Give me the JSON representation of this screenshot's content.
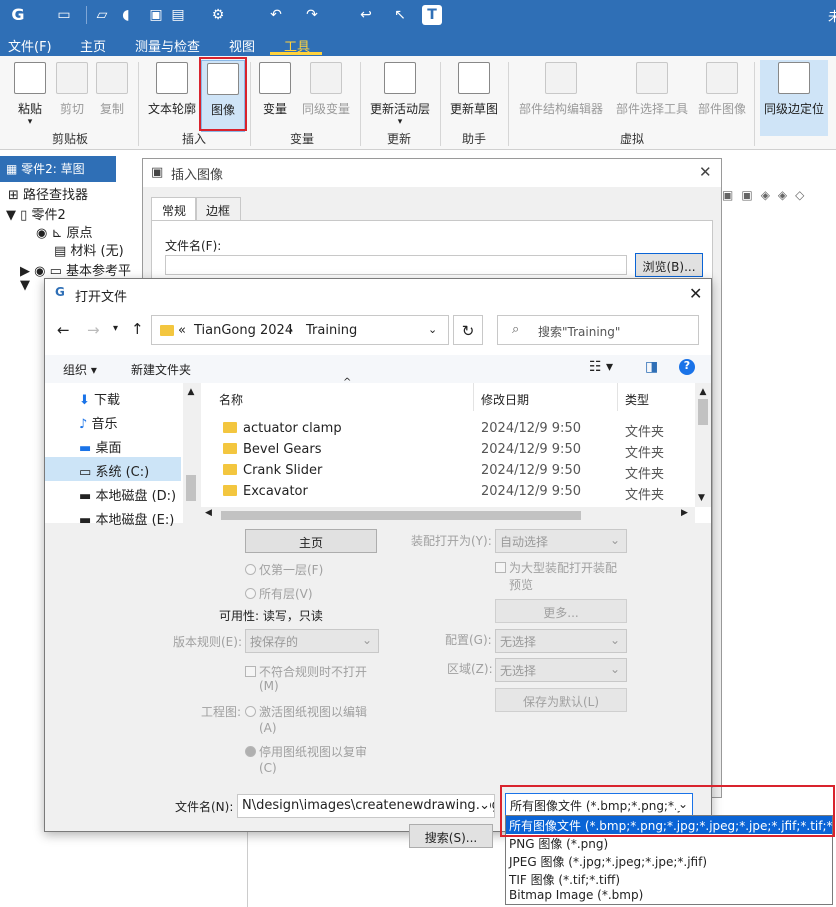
{
  "window": {
    "title_partial": "未"
  },
  "quick_access": [
    "logo-icon",
    "new-icon",
    "open-icon",
    "pin-icon",
    "save-icon",
    "save-as-icon",
    "settings-icon",
    "undo-icon",
    "redo-icon",
    "back-icon",
    "select-icon",
    "t-icon"
  ],
  "menubar": {
    "items": [
      "文件(F)",
      "主页",
      "测量与检查",
      "视图",
      "工具"
    ],
    "active": "工具"
  },
  "ribbon": {
    "groups": [
      {
        "name": "剪贴板",
        "buttons": [
          "粘贴",
          "剪切",
          "复制"
        ]
      },
      {
        "name": "插入",
        "buttons": [
          "文本轮廓",
          "图像"
        ]
      },
      {
        "name": "变量",
        "buttons": [
          "变量",
          "同级变量"
        ]
      },
      {
        "name": "更新",
        "buttons": [
          "更新活动层"
        ]
      },
      {
        "name": "助手",
        "buttons": [
          "更新草图"
        ]
      },
      {
        "name": "虚拟",
        "buttons": [
          "部件结构编辑器",
          "部件选择工具",
          "部件图像",
          "同级边定位"
        ]
      }
    ]
  },
  "document_tab": "零件2: 草图",
  "tree": {
    "title": "路径查找器",
    "items": [
      "零件2",
      "原点",
      "材料 (无)",
      "基本参考平"
    ]
  },
  "insert_image_dialog": {
    "title": "插入图像",
    "tabs": [
      "常规",
      "边框"
    ],
    "filename_label": "文件名(F):",
    "filename_value": "",
    "browse_button": "浏览(B)..."
  },
  "open_file_dialog": {
    "title": "打开文件",
    "breadcrumb": [
      "«",
      "TianGong 2024",
      "Training"
    ],
    "search_placeholder": "搜索\"Training\"",
    "organize": "组织 ▾",
    "new_folder": "新建文件夹",
    "nav_items": [
      "下载",
      "音乐",
      "桌面",
      "系统 (C:)",
      "本地磁盘 (D:)",
      "本地磁盘 (E:)"
    ],
    "selected_nav": "系统 (C:)",
    "columns": [
      "名称",
      "修改日期",
      "类型"
    ],
    "files": [
      {
        "name": "actuator clamp",
        "date": "2024/12/9 9:50",
        "type": "文件夹"
      },
      {
        "name": "Bevel Gears",
        "date": "2024/12/9 9:50",
        "type": "文件夹"
      },
      {
        "name": "Crank Slider",
        "date": "2024/12/9 9:50",
        "type": "文件夹"
      },
      {
        "name": "Excavator",
        "date": "2024/12/9 9:50",
        "type": "文件夹"
      }
    ],
    "options": {
      "home_button": "主页",
      "radio_first_level": "仅第一层(F)",
      "radio_all_levels": "所有层(V)",
      "availability": "可用性: 读写，只读",
      "version_rule_label": "版本规则(E):",
      "version_rule_value": "按保存的",
      "checkbox_noopen": "不符合规则时不打开",
      "checkbox_noopen_key": "(M)",
      "drawing_label": "工程图:",
      "radio_activate": "激活图纸视图以编辑",
      "radio_activate_key": "(A)",
      "radio_deactivate": "停用图纸视图以复审",
      "radio_deactivate_key": "(C)",
      "asm_open_label": "装配打开为(Y):",
      "asm_open_value": "自动选择",
      "large_asm_checkbox": "为大型装配打开装配",
      "large_asm_checkbox_2": "预览",
      "more_button": "更多...",
      "config_label": "配置(G):",
      "config_value": "无选择",
      "zone_label": "区域(Z):",
      "zone_value": "无选择",
      "save_default_button": "保存为默认(L)"
    },
    "filename_label": "文件名(N):",
    "filename_value": "N\\design\\images\\createnewdrawing.jpg",
    "search_button": "搜索(S)...",
    "filetype_value": "所有图像文件 (*.bmp;*.png;*.j",
    "filetype_options": [
      "所有图像文件 (*.bmp;*.png;*.jpg;*.jpeg;*.jpe;*.jfif;*.tif;*.tiff)",
      "PNG 图像 (*.png)",
      "JPEG 图像 (*.jpg;*.jpeg;*.jpe;*.jfif)",
      "TIF 图像 (*.tif;*.tiff)",
      "Bitmap Image (*.bmp)"
    ]
  }
}
